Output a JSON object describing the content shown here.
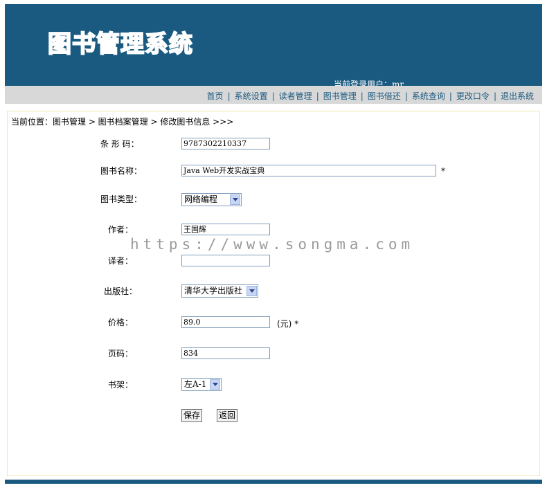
{
  "header": {
    "logo_text": "图书管理系统",
    "login_label": "当前登录用户：",
    "login_user": "mr"
  },
  "nav": {
    "items": [
      "首页",
      "系统设置",
      "读者管理",
      "图书管理",
      "图书借还",
      "系统查询",
      "更改口令",
      "退出系统"
    ],
    "separator": "|"
  },
  "breadcrumb": {
    "text": "当前位置：图书管理 > 图书档案管理 > 修改图书信息 >>>"
  },
  "form": {
    "barcode": {
      "label": "条 形 码：",
      "value": "9787302210337"
    },
    "title": {
      "label": "图书名称：",
      "value": "Java Web开发实战宝典",
      "required": "*"
    },
    "type": {
      "label": "图书类型：",
      "value": "网络编程"
    },
    "author": {
      "label": "作者：",
      "value": "王国辉"
    },
    "translator": {
      "label": "译者：",
      "value": ""
    },
    "publisher": {
      "label": "出版社：",
      "value": "清华大学出版社"
    },
    "price": {
      "label": "价格：",
      "value": "89.0",
      "unit": "(元)",
      "required": "*"
    },
    "pages": {
      "label": "页码：",
      "value": "834"
    },
    "shelf": {
      "label": "书架：",
      "value": "左A-1"
    },
    "save_label": "保存",
    "back_label": "返回"
  },
  "watermark": "https://www.songma.com",
  "colors": {
    "brand": "#1b5a80",
    "nav_bg": "#d8d8d8",
    "border": "#efe7b5"
  }
}
